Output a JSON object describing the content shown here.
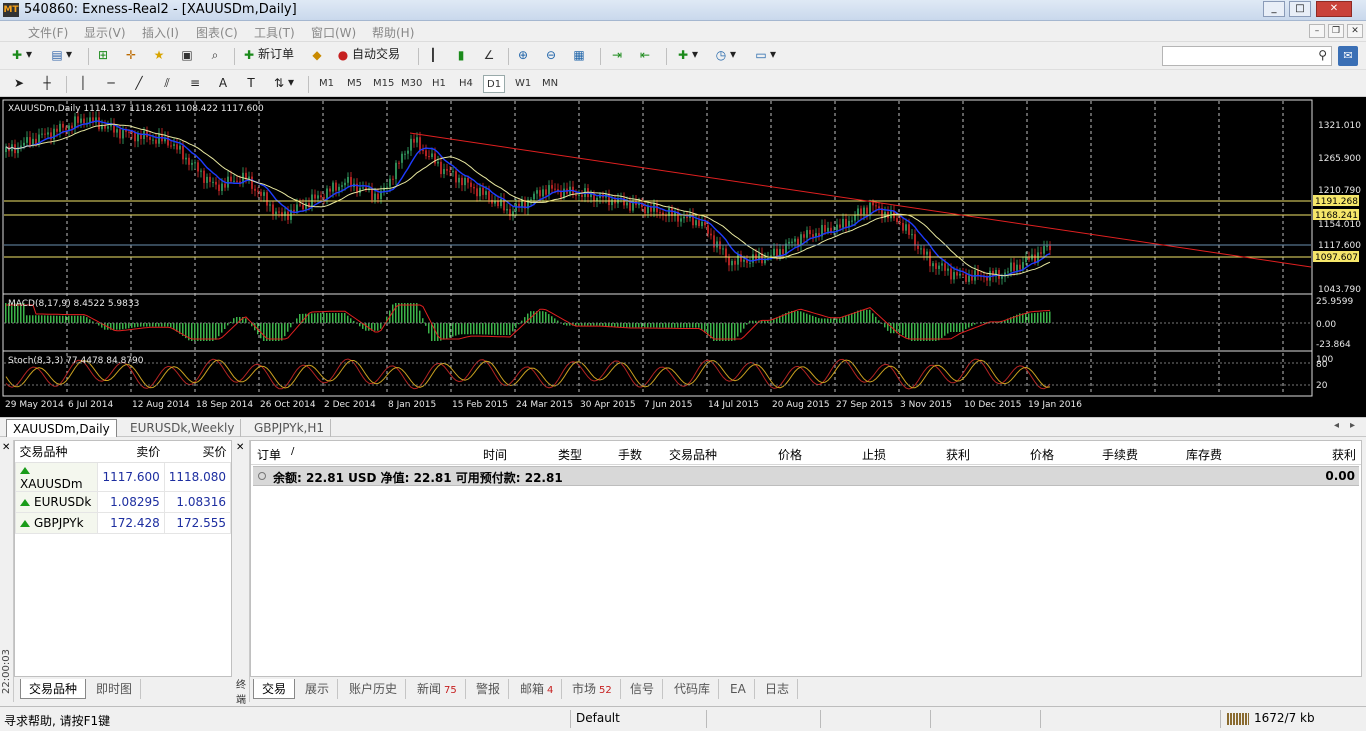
{
  "window": {
    "title": "540860: Exness-Real2 - [XAUUSDm,Daily]",
    "app_icon": "MT"
  },
  "menu": [
    "文件(F)",
    "显示(V)",
    "插入(I)",
    "图表(C)",
    "工具(T)",
    "窗口(W)",
    "帮助(H)"
  ],
  "toolbar": {
    "new_order": "新订单",
    "auto_trading": "自动交易"
  },
  "timeframes": [
    "M1",
    "M5",
    "M15",
    "M30",
    "H1",
    "H4",
    "D1",
    "W1",
    "MN"
  ],
  "active_timeframe": "D1",
  "chart": {
    "header": "XAUUSDm,Daily  1114.137 1118.261 1108.422 1117.600",
    "macd_label": "MACD(8,17,9) 8.4522 5.9833",
    "stoch_label": "Stoch(8,3,3) 77.4478 84.8790",
    "price_ticks": [
      "1321.010",
      "1265.900",
      "1210.790",
      "1154.010",
      "1117.600",
      "1043.790"
    ],
    "hl_levels": [
      "1191.268",
      "1168.241",
      "1097.607"
    ],
    "macd_ticks": [
      "25.9599",
      "0.00",
      "-23.864"
    ],
    "stoch_ticks": [
      "100",
      "80",
      "20"
    ],
    "dates": [
      "29 May 2014",
      "6 Jul 2014",
      "12 Aug 2014",
      "18 Sep 2014",
      "26 Oct 2014",
      "2 Dec 2014",
      "8 Jan 2015",
      "15 Feb 2015",
      "24 Mar 2015",
      "30 Apr 2015",
      "7 Jun 2015",
      "14 Jul 2015",
      "20 Aug 2015",
      "27 Sep 2015",
      "3 Nov 2015",
      "10 Dec 2015",
      "19 Jan 2016"
    ],
    "colors": {
      "bg": "#000000",
      "candle_up": "#2e8b57",
      "candle_down": "#b22222",
      "ma_fast": "#1e3cff",
      "ma_slow": "#e8e8a0",
      "trend": "#e02020",
      "hline": "#f5e66a",
      "hist": "#3cb34a"
    }
  },
  "chart_tabs": [
    "XAUUSDm,Daily",
    "EURUSDk,Weekly",
    "GBPJPYk,H1"
  ],
  "market_watch": {
    "headers": [
      "交易品种",
      "卖价",
      "买价"
    ],
    "rows": [
      {
        "symbol": "XAUUSDm",
        "bid": "1117.600",
        "ask": "1118.080"
      },
      {
        "symbol": "EURUSDk",
        "bid": "1.08295",
        "ask": "1.08316"
      },
      {
        "symbol": "GBPJPYk",
        "bid": "172.428",
        "ask": "172.555"
      }
    ],
    "tabs": [
      "交易品种",
      "即时图"
    ],
    "clock": "22:00:03"
  },
  "terminal": {
    "side_label": "终端",
    "headers": [
      "订单",
      "/",
      "时间",
      "类型",
      "手数",
      "交易品种",
      "价格",
      "止损",
      "获利",
      "价格",
      "手续费",
      "库存费",
      "获利"
    ],
    "balance_text": "余额: 22.81 USD  净值: 22.81  可用预付款: 22.81",
    "balance_value": "0.00",
    "tabs": [
      {
        "label": "交易",
        "badge": ""
      },
      {
        "label": "展示",
        "badge": ""
      },
      {
        "label": "账户历史",
        "badge": ""
      },
      {
        "label": "新闻",
        "badge": "75"
      },
      {
        "label": "警报",
        "badge": ""
      },
      {
        "label": "邮箱",
        "badge": "4"
      },
      {
        "label": "市场",
        "badge": "52"
      },
      {
        "label": "信号",
        "badge": ""
      },
      {
        "label": "代码库",
        "badge": ""
      },
      {
        "label": "EA",
        "badge": ""
      },
      {
        "label": "日志",
        "badge": ""
      }
    ]
  },
  "status": {
    "help": "寻求帮助, 请按F1键",
    "profile": "Default",
    "traffic": "1672/7 kb"
  }
}
